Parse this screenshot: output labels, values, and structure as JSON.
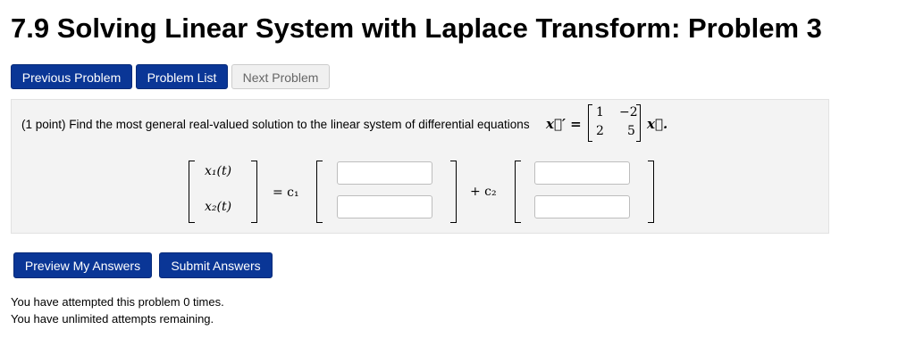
{
  "page": {
    "title": "7.9 Solving Linear System with Laplace Transform: Problem 3"
  },
  "nav": {
    "previous": "Previous Problem",
    "list": "Problem List",
    "next": "Next Problem"
  },
  "problem": {
    "statement": "(1 point) Find the most general real-valued solution to the linear system of differential equations",
    "lhs": "x⃗′ =",
    "matrix": [
      [
        "1",
        "−2"
      ],
      [
        "2",
        "5"
      ]
    ],
    "rhs": "x⃗.",
    "vector_labels": [
      "x₁(t)",
      "x₂(t)"
    ],
    "eq_c1": "= c₁",
    "plus_c2": "+ c₂",
    "inputs": {
      "c1_top": "",
      "c1_bottom": "",
      "c2_top": "",
      "c2_bottom": ""
    }
  },
  "actions": {
    "preview": "Preview My Answers",
    "submit": "Submit Answers"
  },
  "status": {
    "attempts": "You have attempted this problem 0 times.",
    "remaining": "You have unlimited attempts remaining."
  }
}
